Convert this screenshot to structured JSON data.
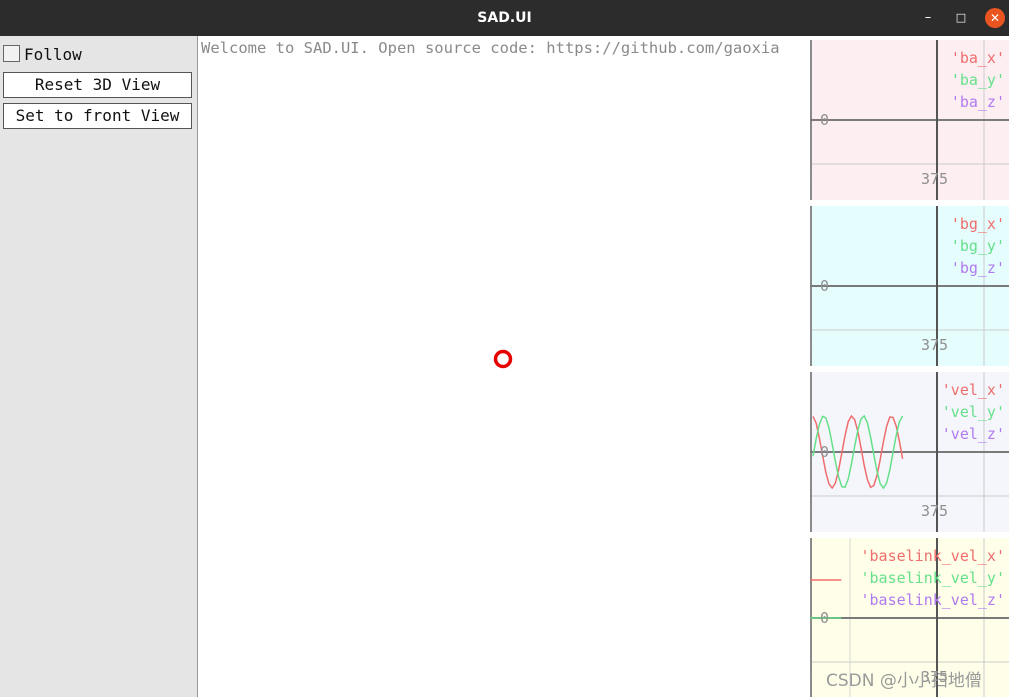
{
  "window": {
    "title": "SAD.UI",
    "min_glyph": "–",
    "max_glyph": "□",
    "close_glyph": "✕"
  },
  "sidebar": {
    "follow_label": "Follow",
    "follow_checked": false,
    "reset_label": "Reset 3D View",
    "front_label": "Set to front View"
  },
  "viewport": {
    "welcome": "Welcome to SAD.UI. Open source code: https://github.com/gaoxia",
    "marker_color": "#e60000"
  },
  "chart_data": [
    {
      "type": "line",
      "background": "#fdeef2",
      "series": [
        {
          "name": "'ba_x'",
          "color": "#f06d6d",
          "x": [],
          "y": []
        },
        {
          "name": "'ba_y'",
          "color": "#66e08a",
          "x": [],
          "y": []
        },
        {
          "name": "'ba_z'",
          "color": "#b07af0",
          "x": [],
          "y": []
        }
      ],
      "x_ticks": [
        "0",
        "375"
      ],
      "y_ticks": [
        "0"
      ]
    },
    {
      "type": "line",
      "background": "#e6fdfd",
      "series": [
        {
          "name": "'bg_x'",
          "color": "#f06d6d",
          "x": [],
          "y": []
        },
        {
          "name": "'bg_y'",
          "color": "#66e08a",
          "x": [],
          "y": []
        },
        {
          "name": "'bg_z'",
          "color": "#b07af0",
          "x": [],
          "y": []
        }
      ],
      "x_ticks": [
        "0",
        "375"
      ],
      "y_ticks": [
        "0"
      ]
    },
    {
      "type": "line",
      "background": "#f5f6fb",
      "series": [
        {
          "name": "'vel_x'",
          "color": "#f06d6d",
          "x": [
            0,
            10,
            20,
            30,
            40,
            50,
            60,
            70,
            80,
            90,
            100,
            110,
            120,
            130,
            140,
            150,
            160,
            170,
            180,
            190,
            200,
            210,
            220,
            230,
            240,
            250,
            260,
            270,
            280
          ],
          "y": [
            0.99,
            0.8,
            0.38,
            -0.1,
            -0.56,
            -0.89,
            -1.0,
            -0.86,
            -0.5,
            -0.03,
            0.45,
            0.84,
            1.0,
            0.9,
            0.58,
            0.12,
            -0.37,
            -0.77,
            -0.98,
            -0.93,
            -0.65,
            -0.21,
            0.28,
            0.71,
            0.97,
            0.96,
            0.72,
            0.3,
            -0.19
          ]
        },
        {
          "name": "'vel_y'",
          "color": "#66e08a",
          "x": [
            0,
            10,
            20,
            30,
            40,
            50,
            60,
            70,
            80,
            90,
            100,
            110,
            120,
            130,
            140,
            150,
            160,
            170,
            180,
            190,
            200,
            210,
            220,
            230,
            240,
            250,
            260,
            270,
            280
          ],
          "y": [
            -0.12,
            0.37,
            0.77,
            0.99,
            0.95,
            0.67,
            0.22,
            -0.27,
            -0.69,
            -0.96,
            -0.98,
            -0.75,
            -0.34,
            0.15,
            0.6,
            0.92,
            1.0,
            0.81,
            0.41,
            -0.07,
            -0.53,
            -0.88,
            -1.0,
            -0.86,
            -0.5,
            -0.02,
            0.46,
            0.84,
            1.0
          ]
        },
        {
          "name": "'vel_z'",
          "color": "#b07af0",
          "x": [],
          "y": []
        }
      ],
      "x_ticks": [
        "0",
        "375"
      ],
      "y_ticks": [
        "0"
      ]
    },
    {
      "type": "line",
      "background": "#fefee9",
      "series": [
        {
          "name": "'baselink_vel_x'",
          "color": "#f06d6d",
          "x": [
            0,
            280
          ],
          "y": [
            1.0,
            1.0
          ]
        },
        {
          "name": "'baselink_vel_y'",
          "color": "#66e08a",
          "x": [
            0,
            280
          ],
          "y": [
            0.0,
            0.0
          ]
        },
        {
          "name": "'baselink_vel_z'",
          "color": "#b07af0",
          "x": [],
          "y": []
        }
      ],
      "x_ticks": [
        "0",
        "375"
      ],
      "y_ticks": [
        "0"
      ]
    }
  ],
  "watermark": "CSDN @小小扫地僧"
}
